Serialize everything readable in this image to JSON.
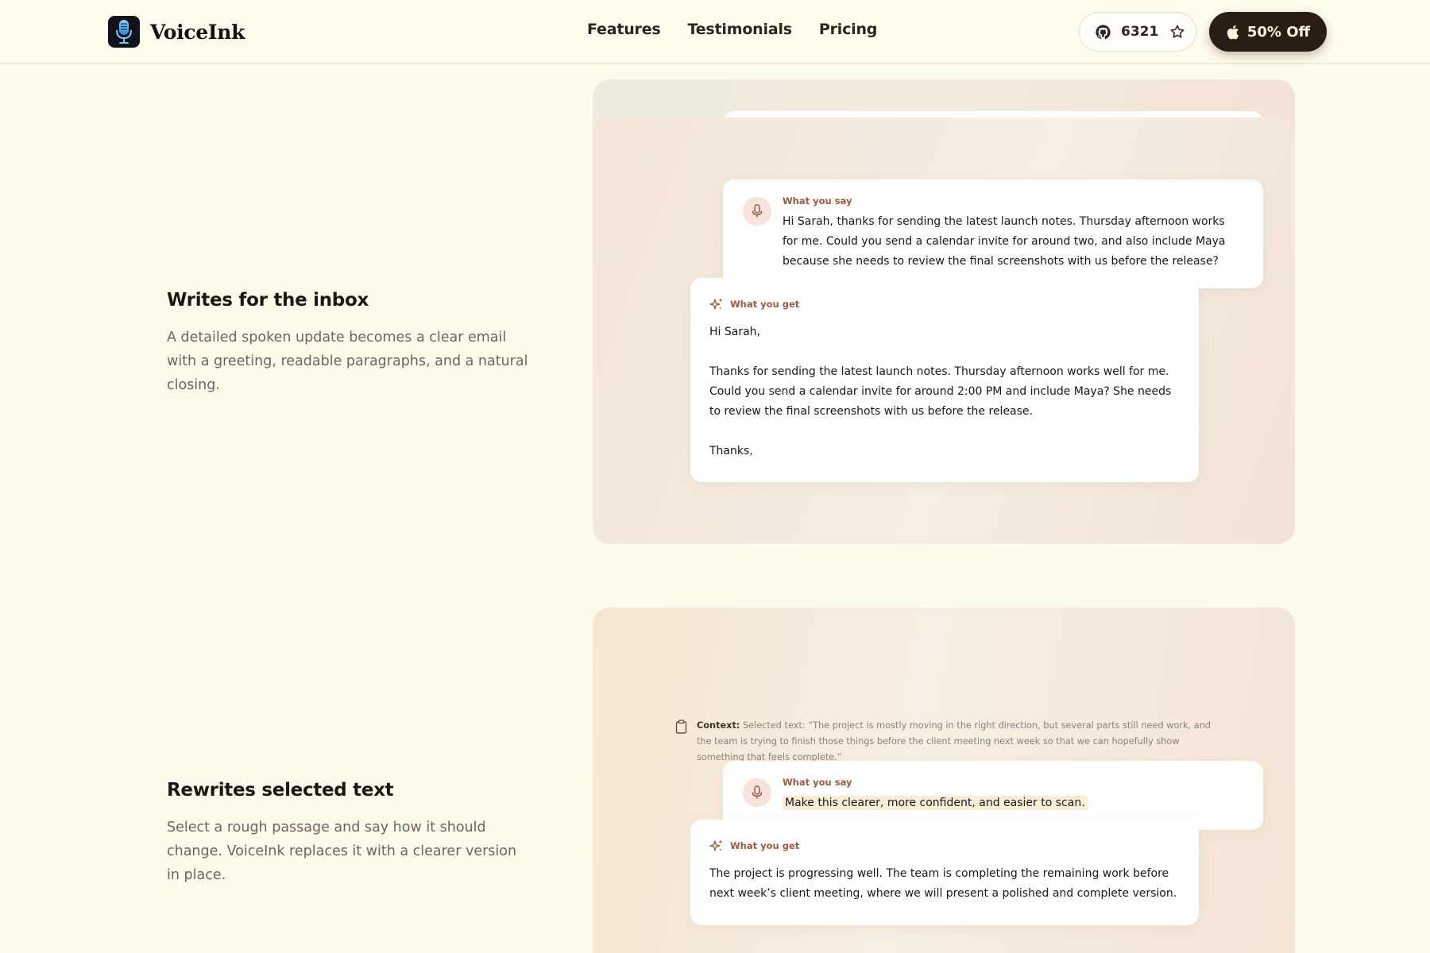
{
  "header": {
    "brand_name": "VoiceInk",
    "nav": [
      {
        "label": "Features"
      },
      {
        "label": "Testimonials"
      },
      {
        "label": "Pricing"
      }
    ],
    "github_stars": "6321",
    "cta_label": "50% Off"
  },
  "features": [
    {
      "title": "Writes for the inbox",
      "description": "A detailed spoken update becomes a clear email with a greeting, readable paragraphs, and a natural closing.",
      "say_label": "What you say",
      "say_text": "Hi Sarah, thanks for sending the latest launch notes. Thursday afternoon works for me. Could you send a calendar invite for around two, and also include Maya because she needs to review the final screenshots with us before the release?",
      "get_label": "What you get",
      "get_greeting": "Hi Sarah,",
      "get_body": "Thanks for sending the latest launch notes. Thursday afternoon works well for me. Could you send a calendar invite for around 2:00 PM and include Maya? She needs to review the final screenshots with us before the release.",
      "get_closing": "Thanks,"
    },
    {
      "title": "Rewrites selected text",
      "description": "Select a rough passage and say how it should change. VoiceInk replaces it with a clearer version in place.",
      "context_label": "Context:",
      "context_text": "Selected text: “The project is mostly moving in the right direction, but several parts still need work, and the team is trying to finish those things before the client meeting next week so that we can hopefully show something that feels complete.”",
      "say_label": "What you say",
      "say_text": "Make this clearer, more confident, and easier to scan.",
      "get_label": "What you get",
      "get_text": "The project is progressing well. The team is completing the remaining work before next week’s client meeting, where we will present a polished and complete version."
    }
  ],
  "colors": {
    "background": "#fffbec",
    "cta_background": "#2a1d13",
    "label_accent": "#9a5a42"
  },
  "icons": [
    "microphone-logo-icon",
    "github-icon",
    "star-icon",
    "apple-icon",
    "mic-icon",
    "sparkle-icon",
    "clipboard-icon"
  ]
}
